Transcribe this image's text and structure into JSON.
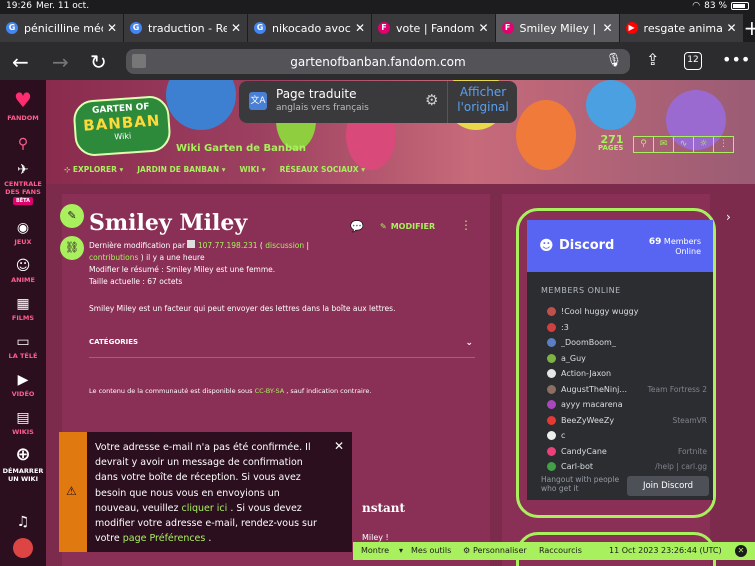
{
  "status": {
    "time": "19:26",
    "date": "Mer. 11 oct.",
    "battery": "83 %"
  },
  "tabs": [
    {
      "title": "pénicilline médi",
      "fav_color": "#4285f4",
      "fav": "G"
    },
    {
      "title": "traduction - Re",
      "fav_color": "#4285f4",
      "fav": "G"
    },
    {
      "title": "nikocado avoca",
      "fav_color": "#4285f4",
      "fav": "G"
    },
    {
      "title": "vote | Fandom",
      "fav_color": "#e0006f",
      "fav": "F"
    },
    {
      "title": "Smiley Miley | W",
      "fav_color": "#e0006f",
      "fav": "F"
    },
    {
      "title": "resgate animal",
      "fav_color": "#ff0000",
      "fav": "▶"
    }
  ],
  "toolbar": {
    "url": "gartenofbanban.fandom.com",
    "tab_count": "12"
  },
  "translate": {
    "title": "Page traduite",
    "subtitle": "anglais vers français",
    "show_original": "Afficher l'original"
  },
  "rail": {
    "brand": "FANDOM",
    "fans": "CENTRALE DES FANS",
    "beta": "BÊTA",
    "games": "JEUX",
    "anime": "ANIME",
    "movies": "FILMS",
    "tv": "LA TÉLÉ",
    "video": "VIDÉO",
    "wikis": "WIKIS",
    "start": "DÉMARRER UN WIKI"
  },
  "wiki": {
    "logo1": "GARTEN OF",
    "logo2": "BANBAN",
    "logo3": "Wiki",
    "name": "Wiki Garten de Banban",
    "pages_count": "271",
    "pages_label": "PAGES",
    "nav": [
      "EXPLORER",
      "JARDIN DE BANBAN",
      "WIKI",
      "RÉSEAUX SOCIAUX"
    ]
  },
  "article": {
    "title": "Smiley Miley",
    "edit": "MODIFIER",
    "meta_prefix": "Dernière modification par",
    "meta_ip": "107.77.198.231",
    "meta_open": "(",
    "meta_discussion": "discussion",
    "meta_sep": "|",
    "meta_contributions": "contributions",
    "meta_time": ") il y a une heure",
    "meta_summary": "Modifier le résumé : Smiley Miley est une femme.",
    "meta_size": "Taille actuelle : 67 octets",
    "summary": "Smiley Miley est un facteur qui peut envoyer des lettres dans la boîte aux lettres.",
    "categories": "CATÉGORIES",
    "license_pre": "Le contenu de la communauté est disponible sous",
    "license_link": "CC-BY-SA",
    "license_post": ", sauf indication contraire.",
    "peek1": "nstant",
    "peek2": "Miley !"
  },
  "discord": {
    "name": "Discord",
    "members_count": "69",
    "members_label": "Members",
    "online_label": "Online",
    "section": "MEMBERS ONLINE",
    "members": [
      {
        "name": "!Cool huggy wuggy",
        "game": "",
        "color": "#c0504d"
      },
      {
        "name": ":3",
        "game": "",
        "color": "#d04040"
      },
      {
        "name": "_DoomBoom_",
        "game": "",
        "color": "#5b7fc0"
      },
      {
        "name": "a_Guy",
        "game": "",
        "color": "#7cb342"
      },
      {
        "name": "Action-Jaxon",
        "game": "",
        "color": "#e6e6e6"
      },
      {
        "name": "AugustTheNinj...",
        "game": "Team Fortress 2",
        "color": "#8d6e63"
      },
      {
        "name": "ayyy macarena",
        "game": "",
        "color": "#ab47bc"
      },
      {
        "name": "BeeZyWeeZy",
        "game": "SteamVR",
        "color": "#e53935"
      },
      {
        "name": "c",
        "game": "",
        "color": "#eeeeee"
      },
      {
        "name": "CandyCane",
        "game": "Fortnite",
        "color": "#ec407a"
      },
      {
        "name": "Carl-bot",
        "game": "/help | carl.gg",
        "color": "#43a047"
      }
    ],
    "footer": "Hangout with people who get it",
    "join": "Join Discord"
  },
  "notice": {
    "text1": "Votre adresse e-mail n'a pas été confirmée. Il devrait y avoir un message de confirmation dans votre boîte de réception. Si vous avez besoin que nous vous en envoyions un nouveau, veuillez ",
    "link1": "cliquer ici",
    "text2": " . Si vous devez modifier votre adresse e-mail, rendez-vous sur votre ",
    "link2": "page Préférences",
    "text3": " ."
  },
  "admin": {
    "more": "Montre",
    "tools": "Mes outils",
    "customize": "Personnaliser",
    "shortcuts": "Raccourcis",
    "timestamp": "11 Oct 2023 23:26:44 (UTC)"
  }
}
